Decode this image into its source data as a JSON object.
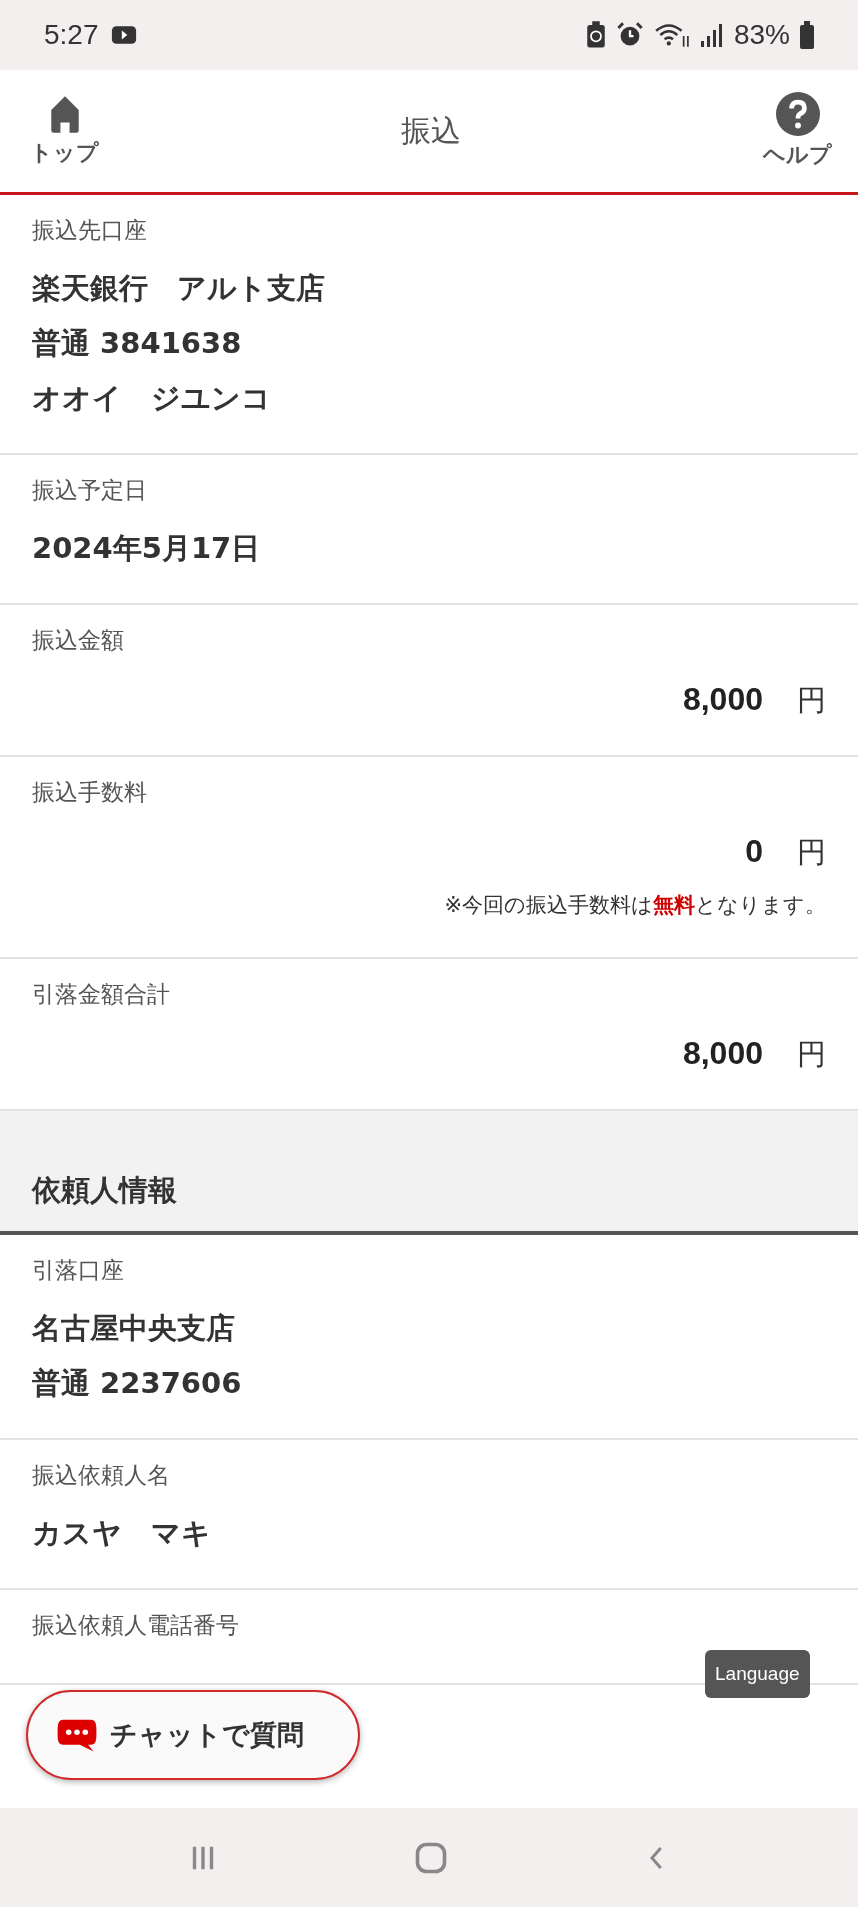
{
  "status_bar": {
    "time": "5:27",
    "battery": "83%"
  },
  "header": {
    "left_label": "トップ",
    "title": "振込",
    "right_label": "ヘルプ"
  },
  "transfer": [
    {
      "label": "振込先口座",
      "kind": "text",
      "lines": [
        "楽天銀行　アルト支店",
        "普通 3841638",
        "オオイ　ジユンコ"
      ]
    },
    {
      "label": "振込予定日",
      "kind": "text",
      "lines": [
        "2024年5月17日"
      ]
    },
    {
      "label": "振込金額",
      "kind": "amount",
      "amount": "8,000",
      "unit": "円"
    },
    {
      "label": "振込手数料",
      "kind": "amount",
      "amount": "0",
      "unit": "円",
      "note": "※今回の振込手数料は**無料**となります。"
    },
    {
      "label": "引落金額合計",
      "kind": "amount",
      "amount": "8,000",
      "unit": "円"
    }
  ],
  "requester": {
    "heading": "依頼人情報",
    "items": [
      {
        "label": "引落口座",
        "kind": "text",
        "lines": [
          "名古屋中央支店",
          "普通 2237606"
        ]
      },
      {
        "label": "振込依頼人名",
        "kind": "text",
        "lines": [
          "カスヤ　マキ"
        ]
      },
      {
        "label": "振込依頼人電話番号",
        "kind": "text"
      }
    ]
  },
  "language_button": "Language",
  "chat_button": "チャットで質問"
}
